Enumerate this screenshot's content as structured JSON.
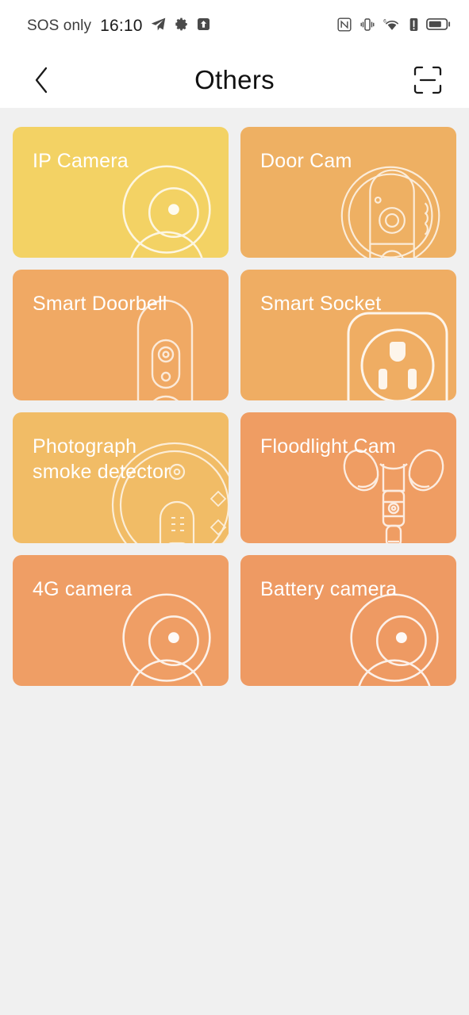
{
  "statusbar": {
    "carrier": "SOS only",
    "time": "16:10",
    "left_icons": [
      "telegram-icon",
      "gear-icon",
      "upload-arrow-icon"
    ],
    "right_icons": [
      "nfc-icon",
      "vibrate-icon",
      "wifi-6-icon",
      "signal-alert-icon",
      "battery-icon"
    ],
    "wifi_generation": "6"
  },
  "header": {
    "back_label": "‹",
    "title": "Others",
    "scan_icon": "scan-frame-icon"
  },
  "colors": {
    "background": "#f0f0f0",
    "surface": "#ffffff",
    "text_primary": "#111111",
    "card_text": "#ffffff"
  },
  "grid": {
    "cards": [
      {
        "label": "IP Camera",
        "color": "#f3d264",
        "art": "camera-lens-art"
      },
      {
        "label": "Door Cam",
        "color": "#eeb063",
        "art": "door-cam-art"
      },
      {
        "label": "Smart Doorbell",
        "color": "#f0a964",
        "art": "doorbell-art"
      },
      {
        "label": "Smart Socket",
        "color": "#efad63",
        "art": "socket-art"
      },
      {
        "label": "Photograph\nsmoke detector",
        "color": "#f1bc66",
        "art": "smoke-detector-art"
      },
      {
        "label": "Floodlight Cam",
        "color": "#ef9d63",
        "art": "floodlight-art"
      },
      {
        "label": "4G camera",
        "color": "#ef9e65",
        "art": "camera-lens-art"
      },
      {
        "label": "Battery camera",
        "color": "#ee9a63",
        "art": "camera-lens-art"
      }
    ]
  }
}
